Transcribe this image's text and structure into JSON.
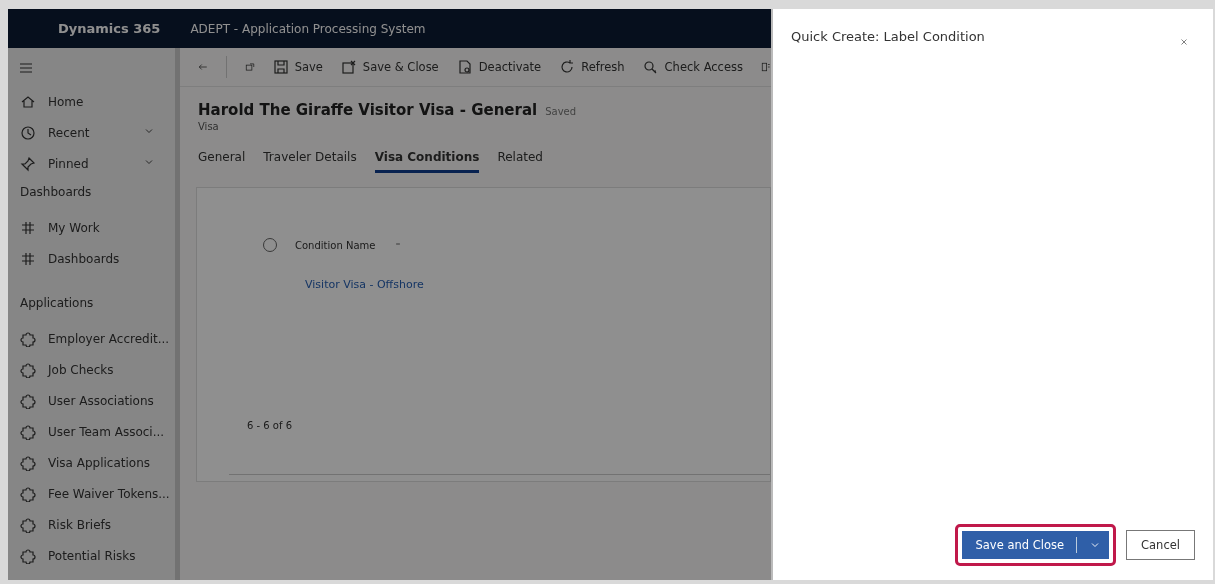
{
  "app_bar": {
    "brand": "Dynamics 365",
    "app_name": "ADEPT - Application Processing System"
  },
  "command_bar": [
    {
      "label": "Save"
    },
    {
      "label": "Save & Close"
    },
    {
      "label": "Deactivate"
    },
    {
      "label": "Refresh"
    },
    {
      "label": "Check Access"
    }
  ],
  "sidebar": {
    "items": [
      {
        "kind": "item",
        "label": "Home",
        "expandable": false
      },
      {
        "kind": "item",
        "label": "Recent",
        "expandable": true
      },
      {
        "kind": "item",
        "label": "Pinned",
        "expandable": true
      },
      {
        "kind": "heading",
        "label": "Dashboards"
      },
      {
        "kind": "item",
        "label": "My Work",
        "expandable": false
      },
      {
        "kind": "item",
        "label": "Dashboards",
        "expandable": false
      },
      {
        "kind": "heading",
        "label": "Applications"
      },
      {
        "kind": "item",
        "label": "Employer Accredit...",
        "expandable": false
      },
      {
        "kind": "item",
        "label": "Job Checks",
        "expandable": false
      },
      {
        "kind": "item",
        "label": "User Associations",
        "expandable": false
      },
      {
        "kind": "item",
        "label": "User Team Associ...",
        "expandable": false
      },
      {
        "kind": "item",
        "label": "Visa Applications",
        "expandable": false
      },
      {
        "kind": "item",
        "label": "Fee Waiver Tokens...",
        "expandable": false
      },
      {
        "kind": "item",
        "label": "Risk Briefs",
        "expandable": false
      },
      {
        "kind": "item",
        "label": "Potential Risks",
        "expandable": false
      }
    ]
  },
  "record": {
    "title": "Harold The Giraffe Visitor Visa - General",
    "status": "Saved",
    "entity": "Visa",
    "tabs": [
      {
        "label": "General",
        "selected": false
      },
      {
        "label": "Traveler Details",
        "selected": false
      },
      {
        "label": "Visa Conditions",
        "selected": true
      },
      {
        "label": "Related",
        "selected": false
      }
    ]
  },
  "subgrid": {
    "select_all_checked": false,
    "column": "Condition Name",
    "rows": [
      "Visitor Visa - Offshore"
    ],
    "pager": "6 - 6 of 6"
  },
  "dialog": {
    "title": "Quick Create: Label Condition",
    "primary_button": "Save and Close",
    "primary_highlighted": true,
    "cancel_button": "Cancel"
  }
}
